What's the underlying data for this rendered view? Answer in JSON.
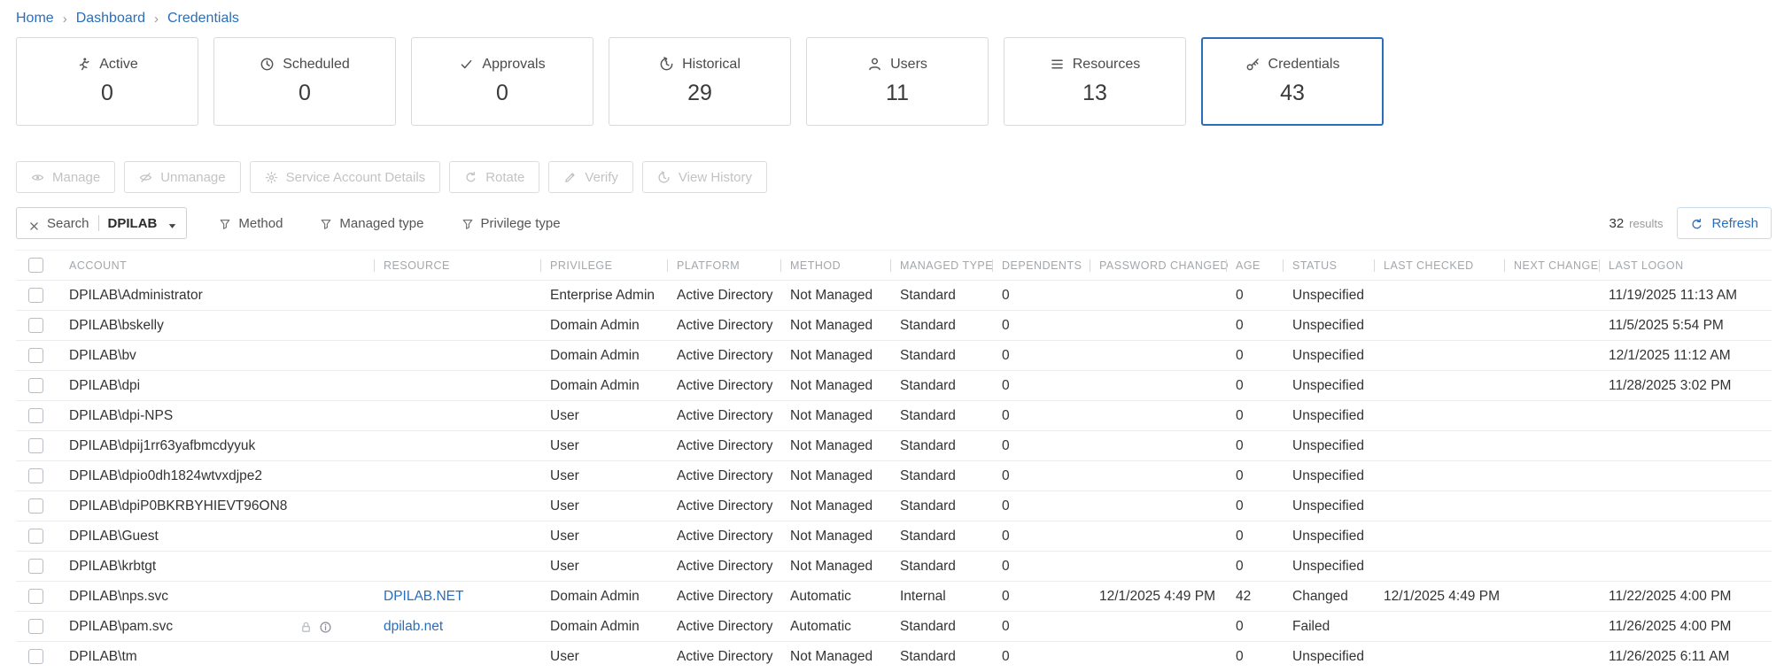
{
  "breadcrumb": {
    "items": [
      "Home",
      "Dashboard",
      "Credentials"
    ],
    "separator": "›"
  },
  "cards": [
    {
      "label": "Active",
      "value": "0",
      "icon": "running-icon",
      "selected": false
    },
    {
      "label": "Scheduled",
      "value": "0",
      "icon": "clock-icon",
      "selected": false
    },
    {
      "label": "Approvals",
      "value": "0",
      "icon": "check-icon",
      "selected": false
    },
    {
      "label": "Historical",
      "value": "29",
      "icon": "history-icon",
      "selected": false
    },
    {
      "label": "Users",
      "value": "11",
      "icon": "user-icon",
      "selected": false
    },
    {
      "label": "Resources",
      "value": "13",
      "icon": "server-icon",
      "selected": false
    },
    {
      "label": "Credentials",
      "value": "43",
      "icon": "key-icon",
      "selected": true
    }
  ],
  "toolbar": {
    "buttons": [
      {
        "label": "Manage",
        "icon": "eye-icon",
        "disabled": true
      },
      {
        "label": "Unmanage",
        "icon": "eye-off-icon",
        "disabled": true
      },
      {
        "label": "Service Account Details",
        "icon": "gear-icon",
        "disabled": true
      },
      {
        "label": "Rotate",
        "icon": "rotate-icon",
        "disabled": true
      },
      {
        "label": "Verify",
        "icon": "pencil-icon",
        "disabled": true
      },
      {
        "label": "View History",
        "icon": "history-icon",
        "disabled": true
      }
    ]
  },
  "filters": {
    "search_chip": {
      "label": "Search",
      "value": "DPILAB"
    },
    "filter_buttons": [
      "Method",
      "Managed type",
      "Privilege type"
    ],
    "results_count": "32",
    "results_label": "results",
    "refresh_label": "Refresh"
  },
  "table": {
    "columns": [
      "ACCOUNT",
      "RESOURCE",
      "PRIVILEGE",
      "PLATFORM",
      "METHOD",
      "MANAGED TYPE",
      "DEPENDENTS",
      "PASSWORD CHANGED",
      "AGE",
      "STATUS",
      "LAST CHECKED",
      "NEXT CHANGE",
      "LAST LOGON"
    ],
    "rows": [
      {
        "account": "DPILAB\\Administrator",
        "resource": "",
        "privilege": "Enterprise Admin",
        "platform": "Active Directory",
        "method": "Not Managed",
        "managed_type": "Standard",
        "dependents": "0",
        "password_changed": "",
        "age": "0",
        "status": "Unspecified",
        "last_checked": "",
        "next_change": "",
        "last_logon": "11/19/2025 11:13 AM"
      },
      {
        "account": "DPILAB\\bskelly",
        "resource": "",
        "privilege": "Domain Admin",
        "platform": "Active Directory",
        "method": "Not Managed",
        "managed_type": "Standard",
        "dependents": "0",
        "password_changed": "",
        "age": "0",
        "status": "Unspecified",
        "last_checked": "",
        "next_change": "",
        "last_logon": "11/5/2025 5:54 PM"
      },
      {
        "account": "DPILAB\\bv",
        "resource": "",
        "privilege": "Domain Admin",
        "platform": "Active Directory",
        "method": "Not Managed",
        "managed_type": "Standard",
        "dependents": "0",
        "password_changed": "",
        "age": "0",
        "status": "Unspecified",
        "last_checked": "",
        "next_change": "",
        "last_logon": "12/1/2025 11:12 AM"
      },
      {
        "account": "DPILAB\\dpi",
        "resource": "",
        "privilege": "Domain Admin",
        "platform": "Active Directory",
        "method": "Not Managed",
        "managed_type": "Standard",
        "dependents": "0",
        "password_changed": "",
        "age": "0",
        "status": "Unspecified",
        "last_checked": "",
        "next_change": "",
        "last_logon": "11/28/2025 3:02 PM"
      },
      {
        "account": "DPILAB\\dpi-NPS",
        "resource": "",
        "privilege": "User",
        "platform": "Active Directory",
        "method": "Not Managed",
        "managed_type": "Standard",
        "dependents": "0",
        "password_changed": "",
        "age": "0",
        "status": "Unspecified",
        "last_checked": "",
        "next_change": "",
        "last_logon": ""
      },
      {
        "account": "DPILAB\\dpij1rr63yafbmcdyyuk",
        "resource": "",
        "privilege": "User",
        "platform": "Active Directory",
        "method": "Not Managed",
        "managed_type": "Standard",
        "dependents": "0",
        "password_changed": "",
        "age": "0",
        "status": "Unspecified",
        "last_checked": "",
        "next_change": "",
        "last_logon": ""
      },
      {
        "account": "DPILAB\\dpio0dh1824wtvxdjpe2",
        "resource": "",
        "privilege": "User",
        "platform": "Active Directory",
        "method": "Not Managed",
        "managed_type": "Standard",
        "dependents": "0",
        "password_changed": "",
        "age": "0",
        "status": "Unspecified",
        "last_checked": "",
        "next_change": "",
        "last_logon": ""
      },
      {
        "account": "DPILAB\\dpiP0BKRBYHIEVT96ON8",
        "resource": "",
        "privilege": "User",
        "platform": "Active Directory",
        "method": "Not Managed",
        "managed_type": "Standard",
        "dependents": "0",
        "password_changed": "",
        "age": "0",
        "status": "Unspecified",
        "last_checked": "",
        "next_change": "",
        "last_logon": ""
      },
      {
        "account": "DPILAB\\Guest",
        "resource": "",
        "privilege": "User",
        "platform": "Active Directory",
        "method": "Not Managed",
        "managed_type": "Standard",
        "dependents": "0",
        "password_changed": "",
        "age": "0",
        "status": "Unspecified",
        "last_checked": "",
        "next_change": "",
        "last_logon": ""
      },
      {
        "account": "DPILAB\\krbtgt",
        "resource": "",
        "privilege": "User",
        "platform": "Active Directory",
        "method": "Not Managed",
        "managed_type": "Standard",
        "dependents": "0",
        "password_changed": "",
        "age": "0",
        "status": "Unspecified",
        "last_checked": "",
        "next_change": "",
        "last_logon": ""
      },
      {
        "account": "DPILAB\\nps.svc",
        "resource": "DPILAB.NET",
        "privilege": "Domain Admin",
        "platform": "Active Directory",
        "method": "Automatic",
        "managed_type": "Internal",
        "dependents": "0",
        "password_changed": "12/1/2025 4:49 PM",
        "age": "42",
        "status": "Changed",
        "last_checked": "12/1/2025 4:49 PM",
        "next_change": "",
        "last_logon": "11/22/2025 4:00 PM"
      },
      {
        "account": "DPILAB\\pam.svc",
        "resource": "dpilab.net",
        "privilege": "Domain Admin",
        "platform": "Active Directory",
        "method": "Automatic",
        "managed_type": "Standard",
        "dependents": "0",
        "password_changed": "",
        "age": "0",
        "status": "Failed",
        "last_checked": "",
        "next_change": "",
        "last_logon": "11/26/2025 4:00 PM",
        "row_icons": [
          "lock-icon",
          "info-icon"
        ]
      },
      {
        "account": "DPILAB\\tm",
        "resource": "",
        "privilege": "User",
        "platform": "Active Directory",
        "method": "Not Managed",
        "managed_type": "Standard",
        "dependents": "0",
        "password_changed": "",
        "age": "0",
        "status": "Unspecified",
        "last_checked": "",
        "next_change": "",
        "last_logon": "11/26/2025 6:11 AM"
      }
    ]
  }
}
